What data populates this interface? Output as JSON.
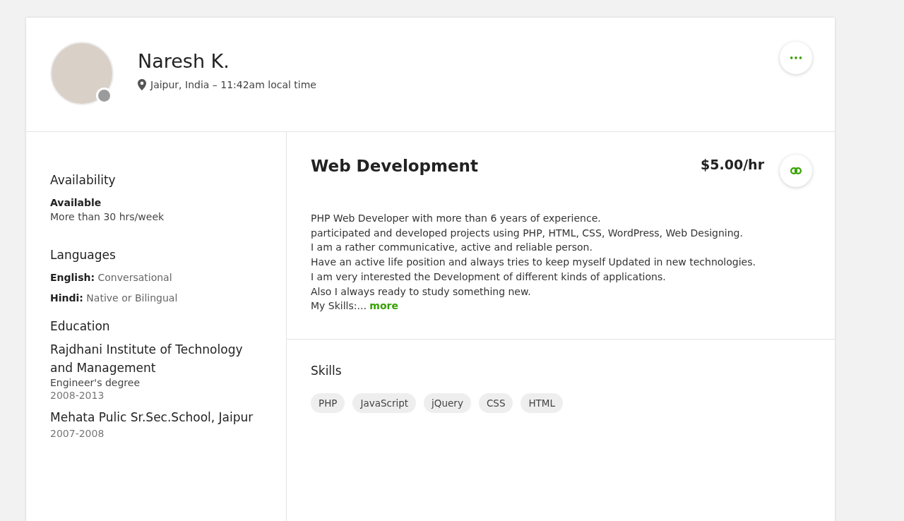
{
  "profile": {
    "name": "Naresh K.",
    "location": "Jaipur, India – 11:42am local time",
    "online": false,
    "more_button": "•••"
  },
  "availability": {
    "title": "Availability",
    "status": "Available",
    "hours": "More than 30 hrs/week"
  },
  "languages": {
    "title": "Languages",
    "items": [
      {
        "name": "English:",
        "level": "Conversational"
      },
      {
        "name": "Hindi:",
        "level": "Native or Bilingual"
      }
    ]
  },
  "education": {
    "title": "Education",
    "items": [
      {
        "school": "Rajdhani Institute of Technology and Management",
        "degree": "Engineer's degree",
        "years": "2008-2013"
      },
      {
        "school": "Mehata Pulic Sr.Sec.School, Jaipur",
        "years": "2007-2008"
      }
    ]
  },
  "job": {
    "title": "Web Development",
    "rate": "$5.00/hr",
    "description_lines": [
      "PHP Web Developer with more than 6 years of experience.",
      "participated and developed projects using PHP, HTML, CSS, WordPress, Web Designing.",
      "I am a rather communicative, active and reliable person.",
      "Have an active life position and always tries to keep myself Updated in new technologies.",
      "I am very interested the Development of different kinds of applications.",
      "Also I always ready to study something new.",
      "My Skills:..."
    ],
    "more_link": "more"
  },
  "skills": {
    "title": "Skills",
    "items": [
      "PHP",
      "JavaScript",
      "jQuery",
      "CSS",
      "HTML"
    ]
  }
}
